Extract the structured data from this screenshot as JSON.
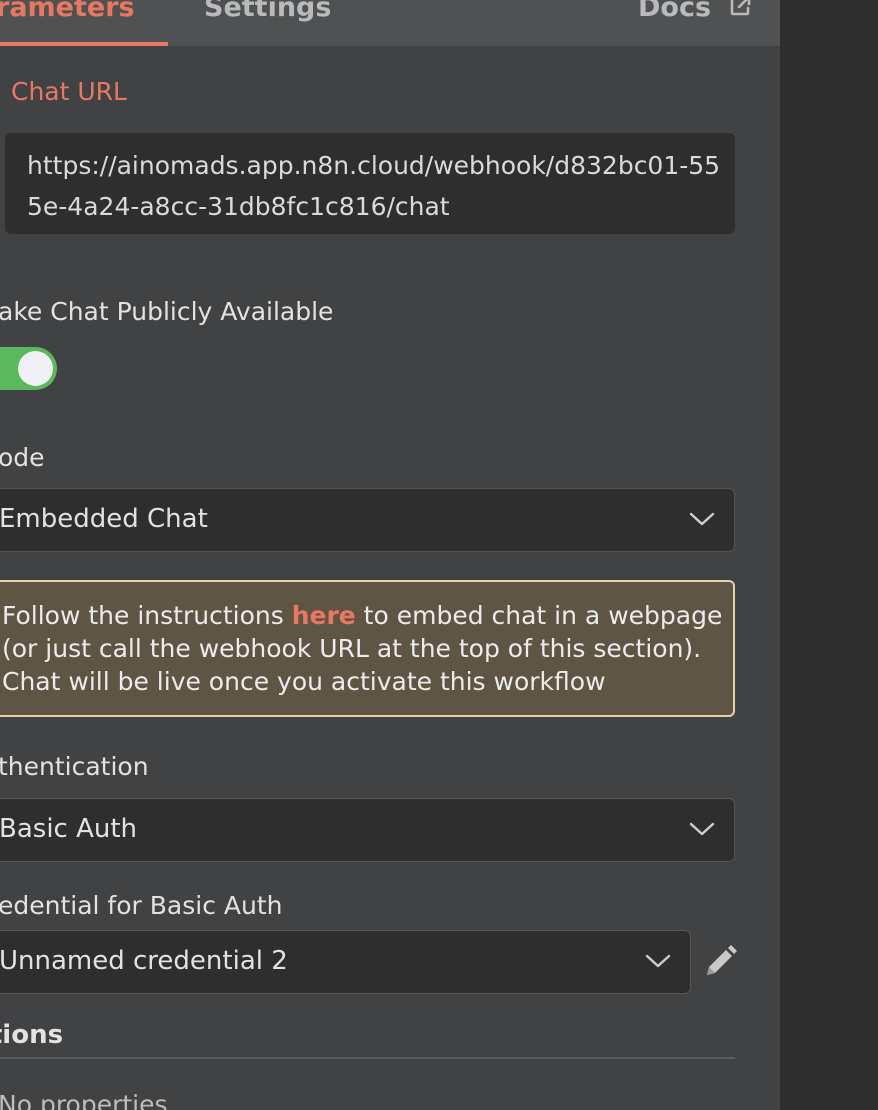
{
  "tabs": {
    "parameters": "rameters",
    "settings": "Settings",
    "docs": "Docs"
  },
  "chat_url": {
    "label": "Chat URL",
    "line1": "https://ainomads.app.n8n.cloud/webhook/d832bc01-55",
    "line2": "5e-4a24-a8cc-31db8fc1c816/chat"
  },
  "public_toggle": {
    "label": "ake Chat Publicly Available",
    "on": true
  },
  "mode": {
    "label": "ode",
    "value": "Embedded Chat"
  },
  "notice": {
    "line1_before": "Follow the instructions ",
    "link": "here",
    "line1_after": " to embed chat in a webpage",
    "line2": "(or just call the webhook URL at the top of this section).",
    "line3": "Chat will be live once you activate this workflow"
  },
  "authentication": {
    "label": "thentication",
    "value": "Basic Auth"
  },
  "credential": {
    "label": "edential for Basic Auth",
    "value": "Unnamed credential 2",
    "edit_icon": "pencil-icon"
  },
  "options": {
    "title": "otions",
    "empty_text": "No properties"
  },
  "colors": {
    "accent": "#e87862",
    "toggle_on": "#5cb85c",
    "notice_bg": "#5e5545",
    "notice_border": "#e6d2a8",
    "panel_bg": "#414244",
    "input_bg": "#2e2e2e"
  }
}
